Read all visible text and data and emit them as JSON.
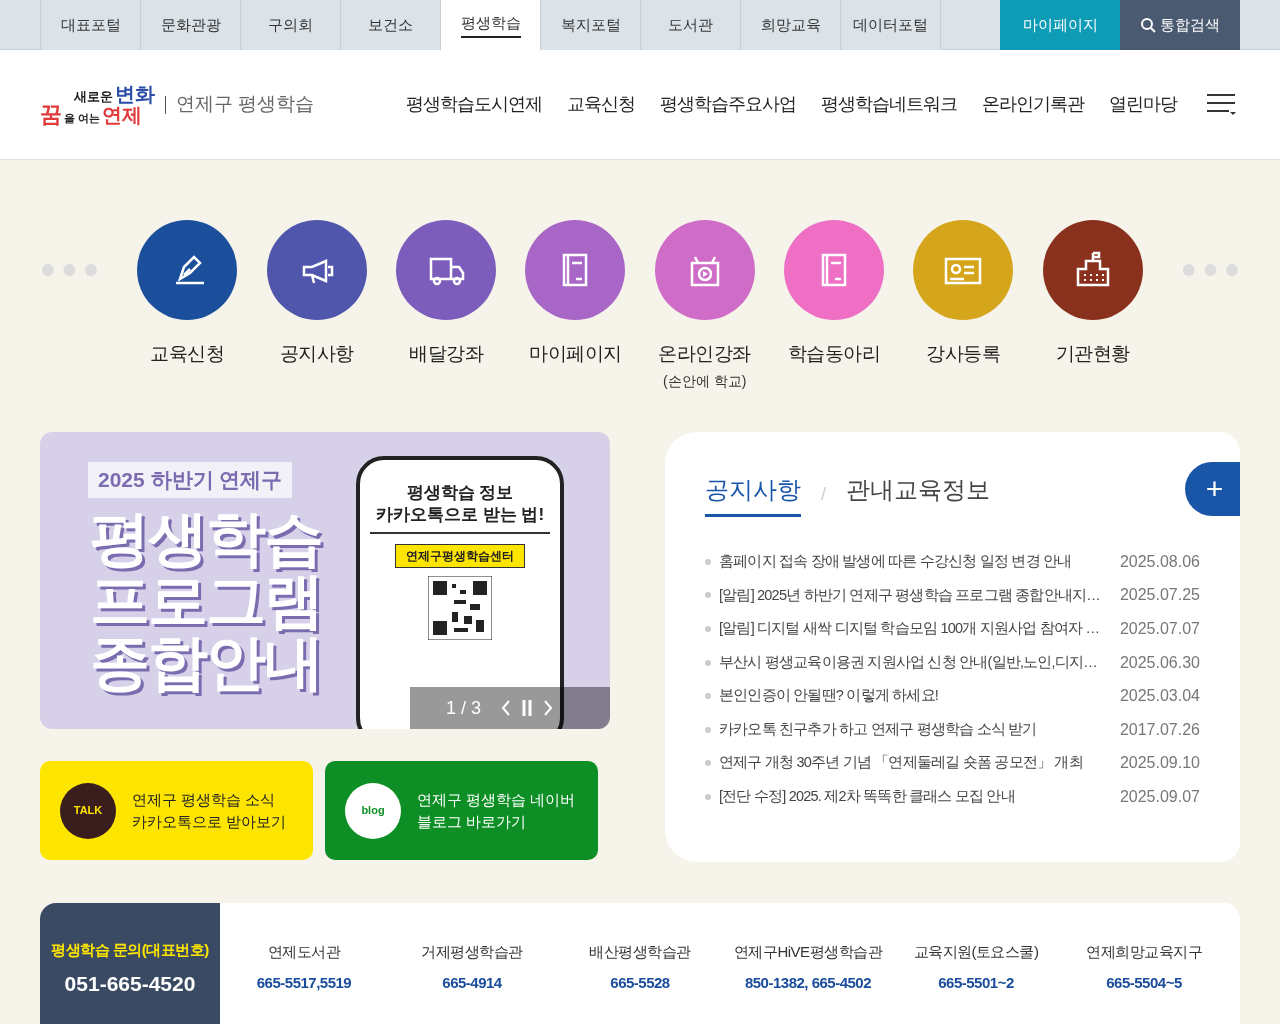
{
  "top_tabs": [
    {
      "label": "대표포털",
      "selected": false
    },
    {
      "label": "문화관광",
      "selected": false
    },
    {
      "label": "구의회",
      "selected": false
    },
    {
      "label": "보건소",
      "selected": false
    },
    {
      "label": "평생학습",
      "selected": true
    },
    {
      "label": "복지포털",
      "selected": false
    },
    {
      "label": "도서관",
      "selected": false
    },
    {
      "label": "희망교육",
      "selected": false
    },
    {
      "label": "데이터포털",
      "selected": false
    }
  ],
  "top_buttons": {
    "mypage": "마이페이지",
    "search": "통합검색"
  },
  "logo": {
    "line_1a": "새로운",
    "line_1b": "변화",
    "line_2a": "꿈",
    "line_2b": "을 여는",
    "line_2c": "연제",
    "site_name": "연제구 평생학습"
  },
  "main_nav": [
    "평생학습도시연제",
    "교육신청",
    "평생학습주요사업",
    "평생학습네트워크",
    "온라인기록관",
    "열린마당"
  ],
  "quick_menu": [
    {
      "label": "교육신청",
      "color": "#1b4f9c"
    },
    {
      "label": "공지사항",
      "color": "#4f56ac"
    },
    {
      "label": "배달강좌",
      "color": "#7c5dbc"
    },
    {
      "label": "마이페이지",
      "color": "#a866c6"
    },
    {
      "label": "온라인강좌",
      "sub": "(손안에 학교)",
      "color": "#cf6cc8"
    },
    {
      "label": "학습동아리",
      "color": "#ee6fc4"
    },
    {
      "label": "강사등록",
      "color": "#d5a51b"
    },
    {
      "label": "기관현황",
      "color": "#8a311d"
    }
  ],
  "banner": {
    "tag": "2025 하반기 연제구",
    "headline": [
      "평생학습",
      "프로그램",
      "종합안내"
    ],
    "phone_title": [
      "평생학습 정보",
      "카카오톡으로 받는 법!"
    ],
    "phone_search": "연제구평생학습센터",
    "pager": "1 / 3"
  },
  "sns_buttons": [
    {
      "kind": "kakao",
      "lines": [
        "연제구 평생학습 소식",
        "카카오톡으로 받아보기"
      ],
      "icon_text": "TALK"
    },
    {
      "kind": "blog",
      "lines": [
        "연제구 평생학습 네이버",
        "블로그 바로가기"
      ],
      "icon_text": "blog"
    }
  ],
  "notice_tabs": [
    {
      "label": "공지사항",
      "selected": true
    },
    {
      "label": "관내교육정보",
      "selected": false
    }
  ],
  "notice_separator": "/",
  "more_button": "+",
  "notices": [
    {
      "title": "홈페이지 접속 장애 발생에 따른 수강신청 일정 변경 안내",
      "date": "2025.08.06"
    },
    {
      "title": "[알림] 2025년 하반기 연제구 평생학습 프로그램 종합안내지…",
      "date": "2025.07.25"
    },
    {
      "title": "[알림] 디지털 새싹 디지털 학습모임 100개 지원사업 참여자 …",
      "date": "2025.07.07"
    },
    {
      "title": "부산시 평생교육이용권 지원사업 신청 안내(일반,노인,디지…",
      "date": "2025.06.30"
    },
    {
      "title": "본인인증이 안될땐? 이렇게 하세요!",
      "date": "2025.03.04"
    },
    {
      "title": "카카오톡 친구추가 하고 연제구 평생학습 소식 받기",
      "date": "2017.07.26"
    },
    {
      "title": "연제구 개청 30주년 기념 「연제둘레길 숏폼 공모전」 개최",
      "date": "2025.09.10"
    },
    {
      "title": "[전단 수정] 2025. 제2차 똑똑한 클래스 모집 안내",
      "date": "2025.09.07"
    }
  ],
  "contact": {
    "label": "평생학습 문의(대표번호)",
    "phone": "051-665-4520",
    "places": [
      {
        "name": "연제도서관",
        "phone": "665-5517,5519"
      },
      {
        "name": "거제평생학습관",
        "phone": "665-4914"
      },
      {
        "name": "배산평생학습관",
        "phone": "665-5528"
      },
      {
        "name": "연제구HiVE평생학습관",
        "phone": "850-1382, 665-4502"
      },
      {
        "name": "교육지원(토요스쿨)",
        "phone": "665-5501~2"
      },
      {
        "name": "연제희망교육지구",
        "phone": "665-5504~5"
      }
    ]
  }
}
